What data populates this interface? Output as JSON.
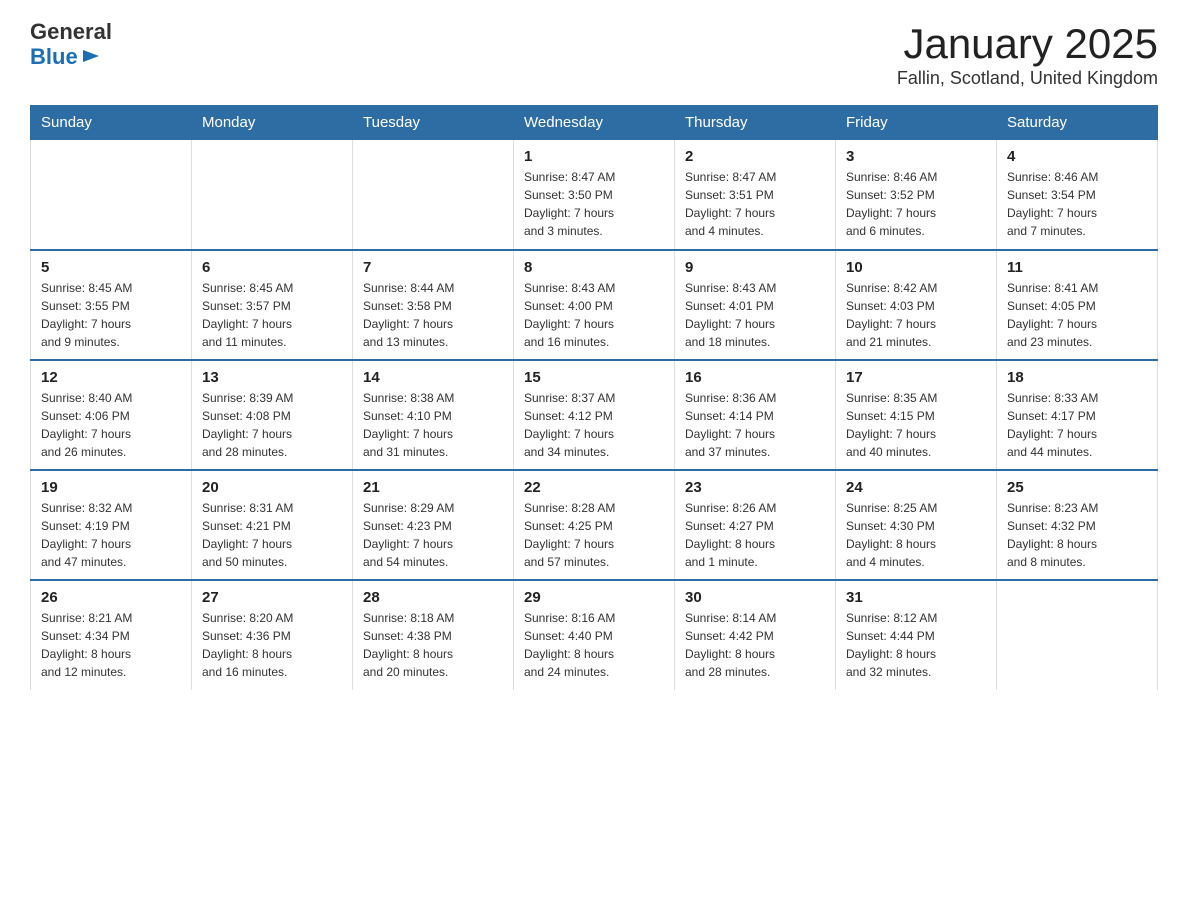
{
  "header": {
    "logo_text_general": "General",
    "logo_text_blue": "Blue",
    "title": "January 2025",
    "subtitle": "Fallin, Scotland, United Kingdom"
  },
  "weekdays": [
    "Sunday",
    "Monday",
    "Tuesday",
    "Wednesday",
    "Thursday",
    "Friday",
    "Saturday"
  ],
  "weeks": [
    [
      {
        "day": "",
        "info": ""
      },
      {
        "day": "",
        "info": ""
      },
      {
        "day": "",
        "info": ""
      },
      {
        "day": "1",
        "info": "Sunrise: 8:47 AM\nSunset: 3:50 PM\nDaylight: 7 hours\nand 3 minutes."
      },
      {
        "day": "2",
        "info": "Sunrise: 8:47 AM\nSunset: 3:51 PM\nDaylight: 7 hours\nand 4 minutes."
      },
      {
        "day": "3",
        "info": "Sunrise: 8:46 AM\nSunset: 3:52 PM\nDaylight: 7 hours\nand 6 minutes."
      },
      {
        "day": "4",
        "info": "Sunrise: 8:46 AM\nSunset: 3:54 PM\nDaylight: 7 hours\nand 7 minutes."
      }
    ],
    [
      {
        "day": "5",
        "info": "Sunrise: 8:45 AM\nSunset: 3:55 PM\nDaylight: 7 hours\nand 9 minutes."
      },
      {
        "day": "6",
        "info": "Sunrise: 8:45 AM\nSunset: 3:57 PM\nDaylight: 7 hours\nand 11 minutes."
      },
      {
        "day": "7",
        "info": "Sunrise: 8:44 AM\nSunset: 3:58 PM\nDaylight: 7 hours\nand 13 minutes."
      },
      {
        "day": "8",
        "info": "Sunrise: 8:43 AM\nSunset: 4:00 PM\nDaylight: 7 hours\nand 16 minutes."
      },
      {
        "day": "9",
        "info": "Sunrise: 8:43 AM\nSunset: 4:01 PM\nDaylight: 7 hours\nand 18 minutes."
      },
      {
        "day": "10",
        "info": "Sunrise: 8:42 AM\nSunset: 4:03 PM\nDaylight: 7 hours\nand 21 minutes."
      },
      {
        "day": "11",
        "info": "Sunrise: 8:41 AM\nSunset: 4:05 PM\nDaylight: 7 hours\nand 23 minutes."
      }
    ],
    [
      {
        "day": "12",
        "info": "Sunrise: 8:40 AM\nSunset: 4:06 PM\nDaylight: 7 hours\nand 26 minutes."
      },
      {
        "day": "13",
        "info": "Sunrise: 8:39 AM\nSunset: 4:08 PM\nDaylight: 7 hours\nand 28 minutes."
      },
      {
        "day": "14",
        "info": "Sunrise: 8:38 AM\nSunset: 4:10 PM\nDaylight: 7 hours\nand 31 minutes."
      },
      {
        "day": "15",
        "info": "Sunrise: 8:37 AM\nSunset: 4:12 PM\nDaylight: 7 hours\nand 34 minutes."
      },
      {
        "day": "16",
        "info": "Sunrise: 8:36 AM\nSunset: 4:14 PM\nDaylight: 7 hours\nand 37 minutes."
      },
      {
        "day": "17",
        "info": "Sunrise: 8:35 AM\nSunset: 4:15 PM\nDaylight: 7 hours\nand 40 minutes."
      },
      {
        "day": "18",
        "info": "Sunrise: 8:33 AM\nSunset: 4:17 PM\nDaylight: 7 hours\nand 44 minutes."
      }
    ],
    [
      {
        "day": "19",
        "info": "Sunrise: 8:32 AM\nSunset: 4:19 PM\nDaylight: 7 hours\nand 47 minutes."
      },
      {
        "day": "20",
        "info": "Sunrise: 8:31 AM\nSunset: 4:21 PM\nDaylight: 7 hours\nand 50 minutes."
      },
      {
        "day": "21",
        "info": "Sunrise: 8:29 AM\nSunset: 4:23 PM\nDaylight: 7 hours\nand 54 minutes."
      },
      {
        "day": "22",
        "info": "Sunrise: 8:28 AM\nSunset: 4:25 PM\nDaylight: 7 hours\nand 57 minutes."
      },
      {
        "day": "23",
        "info": "Sunrise: 8:26 AM\nSunset: 4:27 PM\nDaylight: 8 hours\nand 1 minute."
      },
      {
        "day": "24",
        "info": "Sunrise: 8:25 AM\nSunset: 4:30 PM\nDaylight: 8 hours\nand 4 minutes."
      },
      {
        "day": "25",
        "info": "Sunrise: 8:23 AM\nSunset: 4:32 PM\nDaylight: 8 hours\nand 8 minutes."
      }
    ],
    [
      {
        "day": "26",
        "info": "Sunrise: 8:21 AM\nSunset: 4:34 PM\nDaylight: 8 hours\nand 12 minutes."
      },
      {
        "day": "27",
        "info": "Sunrise: 8:20 AM\nSunset: 4:36 PM\nDaylight: 8 hours\nand 16 minutes."
      },
      {
        "day": "28",
        "info": "Sunrise: 8:18 AM\nSunset: 4:38 PM\nDaylight: 8 hours\nand 20 minutes."
      },
      {
        "day": "29",
        "info": "Sunrise: 8:16 AM\nSunset: 4:40 PM\nDaylight: 8 hours\nand 24 minutes."
      },
      {
        "day": "30",
        "info": "Sunrise: 8:14 AM\nSunset: 4:42 PM\nDaylight: 8 hours\nand 28 minutes."
      },
      {
        "day": "31",
        "info": "Sunrise: 8:12 AM\nSunset: 4:44 PM\nDaylight: 8 hours\nand 32 minutes."
      },
      {
        "day": "",
        "info": ""
      }
    ]
  ]
}
